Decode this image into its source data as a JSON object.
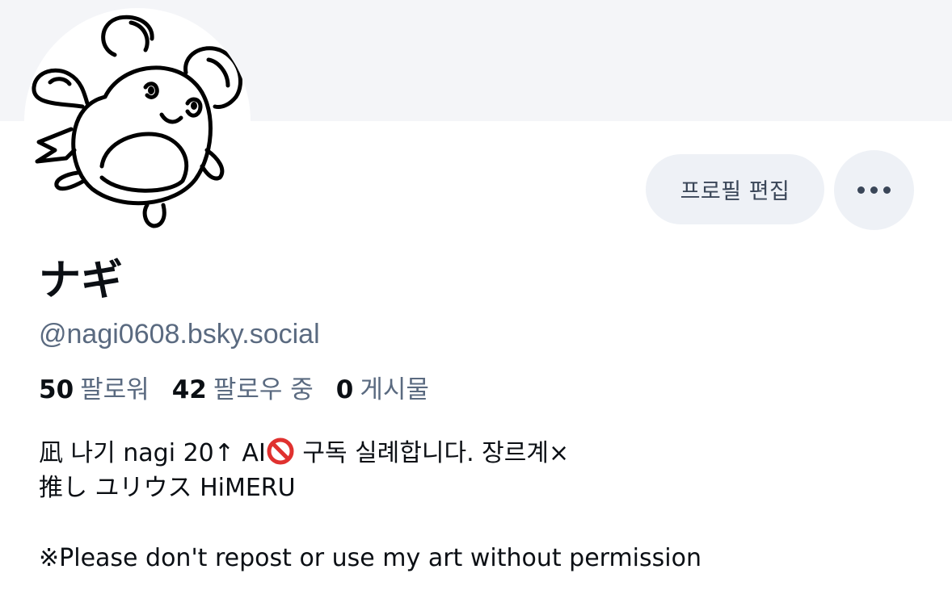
{
  "profile": {
    "display_name": "ナギ",
    "handle": "@nagi0608.bsky.social"
  },
  "actions": {
    "edit_label": "프로필 편집",
    "more_icon": "ellipsis-icon"
  },
  "stats": {
    "followers_count": "50",
    "followers_label": "팔로워",
    "following_count": "42",
    "following_label": "팔로우 중",
    "posts_count": "0",
    "posts_label": "게시물"
  },
  "bio": {
    "line1_a": "凪 나기 nagi 20↑ AI",
    "line1_b": " 구독 실례합니다. 장르계×",
    "line2": "推し ユリウス HiMERU",
    "line3": "※Please don't repost or use my art without permission",
    "no_ai_icon": "prohibited-icon"
  },
  "colors": {
    "banner": "#f4f5f8",
    "button_bg": "#eef1f6",
    "muted_text": "#5a6a80",
    "prohibited_red": "#e0312f"
  }
}
